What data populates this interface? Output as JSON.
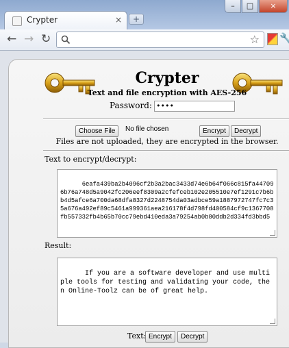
{
  "browser": {
    "tab_title": "Crypter",
    "tab_close": "×",
    "new_tab": "+",
    "win_min": "–",
    "win_max": "□",
    "win_close": "×",
    "back": "←",
    "forward": "→",
    "reload": "↻",
    "star": "☆",
    "wrench": "🔧",
    "url_value": ""
  },
  "page": {
    "title": "Crypter",
    "subtitle": "Text and file encryption with AES-256",
    "password_label": "Password:",
    "password_value": "••••",
    "choose_file": "Choose File",
    "no_file": "No file chosen",
    "encrypt": "Encrypt",
    "decrypt": "Decrypt",
    "notice": "Files are not uploaded, they are encrypted in the browser.",
    "input_label": "Text to encrypt/decrypt:",
    "input_value": "6eafa439ba2b4096cf2b3a2bac3433d74e6b64f066c815fa447096b76a748d5a9042fc206eef8309a2cfefceb102e205510e7ef1291c7b6bb4d5afce6a700da68dfa8327d2248754da03adbce59a1887972747fc7c35a676a492ef89c5461a999361aea216178f4d798fd400584cf9c1367708fb557332fb4b65b70cc79ebd410eda3a79254ab0b80ddb2d334fd3bbd5",
    "result_label": "Result:",
    "result_value": "If you are a software developer and use multiple tools for testing and validating your code, then Online-Toolz can be of great help.",
    "text_label": "Text:",
    "text_encrypt": "Encrypt",
    "text_decrypt": "Decrypt"
  }
}
